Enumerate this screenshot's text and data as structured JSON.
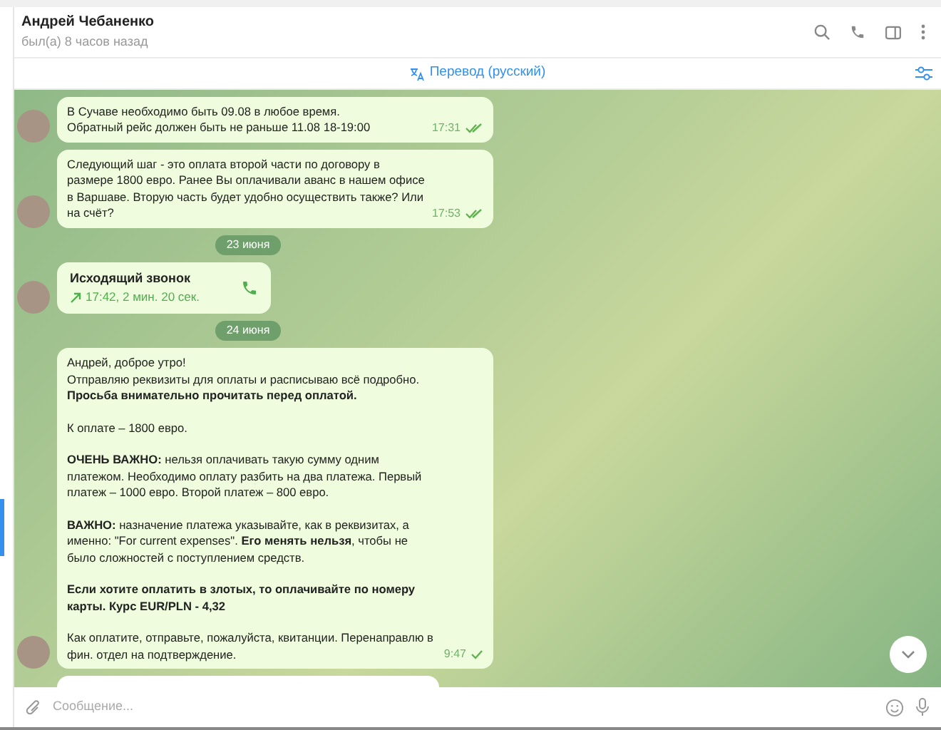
{
  "header": {
    "name": "Андрей Чебаненко",
    "status": "был(а) 8 часов назад"
  },
  "translate_bar": {
    "label": "Перевод (русский)"
  },
  "messages": [
    {
      "kind": "text",
      "paragraphs": [
        "В Сучаве необходимо быть 09.08 в любое время.\nОбратный рейс должен быть не раньше 11.08 18-19:00"
      ],
      "time": "17:31",
      "read": true
    },
    {
      "kind": "text",
      "paragraphs": [
        "Следующий шаг - это оплата второй части по договору в размере 1800 евро. Ранее Вы оплачивали аванс в нашем офисе в Варшаве. Вторую часть будет удобно осуществить также? Или на счёт?"
      ],
      "time": "17:53",
      "read": true
    },
    {
      "kind": "date",
      "label": "23 июня"
    },
    {
      "kind": "call",
      "title": "Исходящий звонок",
      "detail": "17:42, 2 мин. 20 сек."
    },
    {
      "kind": "date",
      "label": "24 июня"
    },
    {
      "kind": "text",
      "paragraphs": [
        "Андрей, доброе утро!\nОтправляю реквизиты для оплаты и расписываю всё подробно.\n**Просьба внимательно прочитать перед оплатой.**",
        "К оплате – 1800 евро.",
        "**ОЧЕНЬ ВАЖНО:** нельзя оплачивать такую сумму одним платежом. Необходимо оплату разбить на два платежа. Первый платеж – 1000 евро. Второй платеж – 800 евро.",
        "**ВАЖНО:** назначение платежа указывайте, как в реквизитах, а именно: \"For current expenses\". **Его менять нельзя**, чтобы не было сложностей с поступлением средств.",
        "**Если хотите оплатить в злотых, то оплачивайте по номеру карты. Курс EUR/PLN - 4,32**",
        "Как оплатите, отправьте, пожалуйста, квитанции. Перенаправлю в фин. отдел на подтверждение."
      ],
      "time": "9:47",
      "read": false
    }
  ],
  "composer": {
    "placeholder": "Сообщение..."
  }
}
